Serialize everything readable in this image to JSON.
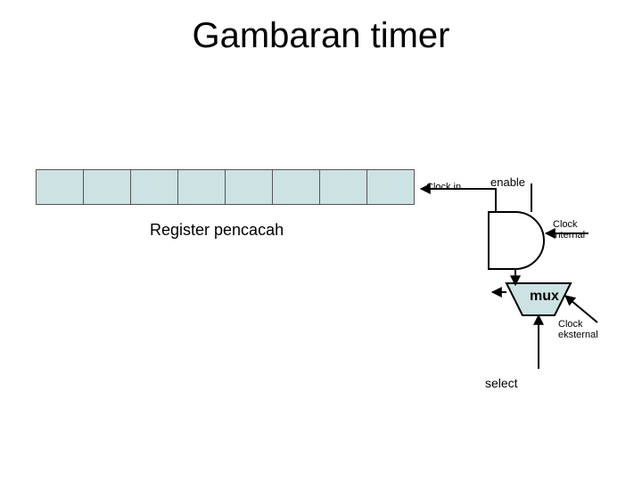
{
  "title": "Gambaran timer",
  "register": {
    "label": "Register pencacah",
    "cell_count": 8
  },
  "labels": {
    "clock_in": "Clock in",
    "enable": "enable",
    "clock_internal": "Clock\ninternal",
    "mux": "mux",
    "clock_eksternal": "Clock\neksternal",
    "select": "select"
  },
  "colors": {
    "cell_fill": "#cde2e2",
    "outline": "#555"
  }
}
